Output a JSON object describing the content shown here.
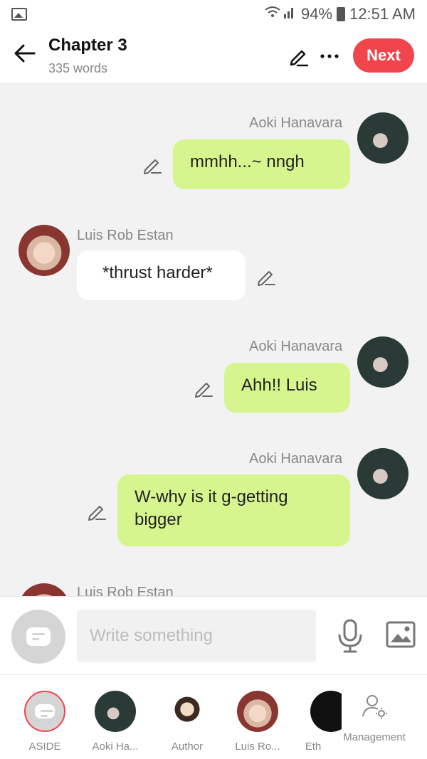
{
  "status_bar": {
    "battery": "94%",
    "time": "12:51 AM"
  },
  "header": {
    "title": "Chapter 3",
    "word_count": "335 words",
    "next_label": "Next"
  },
  "messages": [
    {
      "side": "right",
      "author": "Aoki Hanavara",
      "text": "mmhh...~  nngh"
    },
    {
      "side": "left",
      "author": "Luis Rob Estan",
      "text": "*thrust harder*"
    },
    {
      "side": "right",
      "author": "Aoki Hanavara",
      "text": "Ahh!! Luis"
    },
    {
      "side": "right",
      "author": "Aoki Hanavara",
      "text": "W-why is it g-getting bigger"
    },
    {
      "side": "left",
      "author": "Luis Rob Estan",
      "text": ""
    }
  ],
  "composer": {
    "placeholder": "Write something",
    "value": ""
  },
  "characters": [
    {
      "label": "ASIDE"
    },
    {
      "label": "Aoki Ha..."
    },
    {
      "label": "Author"
    },
    {
      "label": "Luis Ro..."
    },
    {
      "label": "Eth"
    }
  ],
  "management_label": "Management",
  "colors": {
    "accent": "#f0454c",
    "green_bubble": "#d7f58f",
    "background": "#f2f2f2"
  }
}
